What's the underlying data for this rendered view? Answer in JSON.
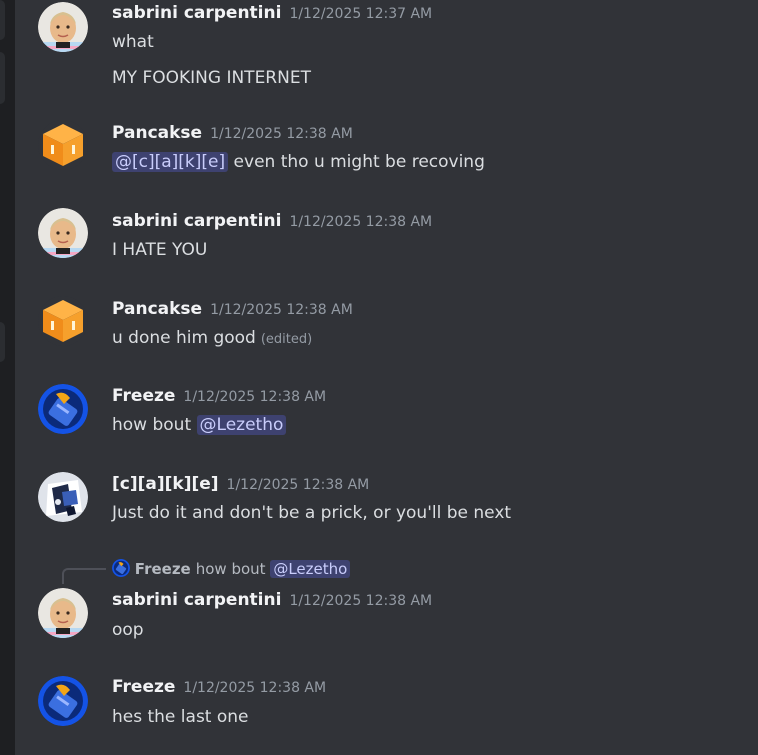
{
  "messages": [
    {
      "author": "sabrini carpentini",
      "time": "1/12/2025 12:37 AM",
      "lines": [
        "what",
        "MY FOOKING INTERNET"
      ]
    },
    {
      "author": "Pancakse",
      "time": "1/12/2025 12:38 AM",
      "mention": "@[c][a][k][e]",
      "text": "even tho u might be recoving"
    },
    {
      "author": "sabrini carpentini",
      "time": "1/12/2025 12:38 AM",
      "text": "I HATE YOU"
    },
    {
      "author": "Pancakse",
      "time": "1/12/2025 12:38 AM",
      "text": "u done him good",
      "edited": "(edited)"
    },
    {
      "author": "Freeze",
      "time": "1/12/2025 12:38 AM",
      "text": "how bout",
      "mention": "@Lezetho"
    },
    {
      "author": "[c][a][k][e]",
      "time": "1/12/2025 12:38 AM",
      "text": "Just do it and don't be a prick, or you'll be next"
    },
    {
      "reply": {
        "author": "Freeze",
        "text": "how bout",
        "mention": "@Lezetho"
      },
      "author": "sabrini carpentini",
      "time": "1/12/2025 12:38 AM",
      "text": "oop"
    },
    {
      "author": "Freeze",
      "time": "1/12/2025 12:38 AM",
      "text": "hes the last one"
    }
  ],
  "colors": {
    "background": "#313338",
    "mention_bg": "#3e4270",
    "mention_fg": "#c9cdfb",
    "timestamp": "#949ba4"
  },
  "icons": {
    "pancakse": "orange-cube-avatar",
    "freeze": "blue-character-avatar",
    "sabrini": "photo-avatar",
    "cake": "photo-avatar"
  }
}
